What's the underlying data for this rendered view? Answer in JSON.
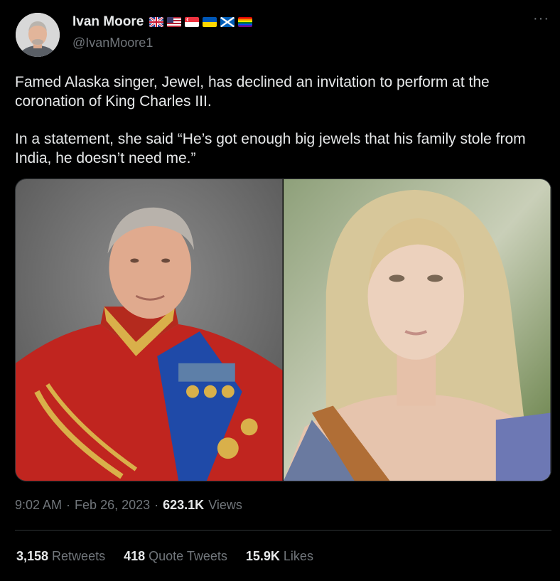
{
  "author": {
    "display_name": "Ivan Moore",
    "handle": "@IvanMoore1",
    "flags": [
      "uk-flag-icon",
      "us-flag-icon",
      "singapore-flag-icon",
      "ukraine-flag-icon",
      "scotland-flag-icon",
      "rainbow-flag-icon"
    ]
  },
  "tweet": {
    "paragraph_1": "Famed Alaska singer, Jewel, has declined an invitation to perform at the coronation of King Charles III.",
    "paragraph_2": "In a statement, she said “He’s got enough big jewels that his family stole from India, he doesn’t need me.”",
    "more_label": "···"
  },
  "media": {
    "images": [
      "portrait-king-charles-uniform",
      "portrait-blonde-woman"
    ]
  },
  "meta": {
    "time": "9:02 AM",
    "separator": "·",
    "date": "Feb 26, 2023",
    "views_count": "623.1K",
    "views_label": "Views"
  },
  "stats": {
    "retweets_count": "3,158",
    "retweets_label": "Retweets",
    "quotes_count": "418",
    "quotes_label": "Quote Tweets",
    "likes_count": "15.9K",
    "likes_label": "Likes"
  },
  "colors": {
    "background": "#000000",
    "text_primary": "#e7e9ea",
    "text_secondary": "#71767b",
    "divider": "#2f3336"
  }
}
